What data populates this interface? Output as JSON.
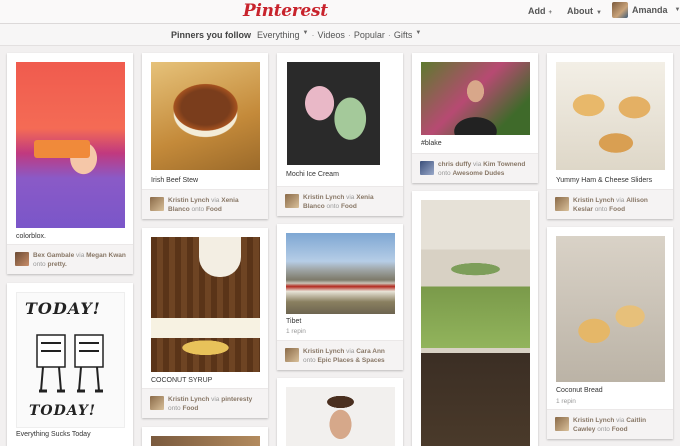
{
  "header": {
    "logo": "Pinterest",
    "add": "Add",
    "about": "About",
    "user": "Amanda"
  },
  "subnav": {
    "active": "Pinners you follow",
    "items": [
      "Everything",
      "Videos",
      "Popular",
      "Gifts"
    ]
  },
  "pins": {
    "colorblox": {
      "desc": "colorblox.",
      "user": "Bex Gambale",
      "via": "via",
      "via_user": "Megan Kwan",
      "onto": "onto",
      "board": "pretty."
    },
    "today": {
      "desc": "Everything Sucks Today",
      "art_top": "TODAY!",
      "art_bottom": "TODAY!"
    },
    "stew": {
      "desc": "Irish Beef Stew",
      "user": "Kristin Lynch",
      "via": "via",
      "via_user": "Xenia Blanco",
      "onto": "onto",
      "board": "Food"
    },
    "syrup": {
      "desc": "COCONUT SYRUP",
      "user": "Kristin Lynch",
      "via": "via",
      "via_user": "pinteresty",
      "onto": "onto",
      "board": "Food"
    },
    "mochi": {
      "desc": "Mochi Ice Cream",
      "user": "Kristin Lynch",
      "via": "via",
      "via_user": "Xenia Blanco",
      "onto": "onto",
      "board": "Food"
    },
    "tibet": {
      "desc": "Tibet",
      "repins": "1 repin",
      "user": "Kristin Lynch",
      "via": "via",
      "via_user": "Cara Ann",
      "onto": "onto",
      "board": "Epic Places & Spaces"
    },
    "blake": {
      "desc": "#blake",
      "user": "chris duffy",
      "via": "via",
      "via_user": "Kim Townend",
      "onto": "onto",
      "board": "Awesome Dudes"
    },
    "sliders": {
      "desc": "Yummy Ham & Cheese Sliders",
      "user": "Kristin Lynch",
      "via": "via",
      "via_user": "Allison Keslar",
      "onto": "onto",
      "board": "Food"
    },
    "bread": {
      "desc": "Coconut Bread",
      "repins": "1 repin",
      "user": "Kristin Lynch",
      "via": "via",
      "via_user": "Caitlin Cawley",
      "onto": "onto",
      "board": "Food"
    }
  },
  "colors": {
    "brand": "#c8232c",
    "page_bg": "#f2f0f0",
    "attribution_bg": "#f5f3f3"
  }
}
